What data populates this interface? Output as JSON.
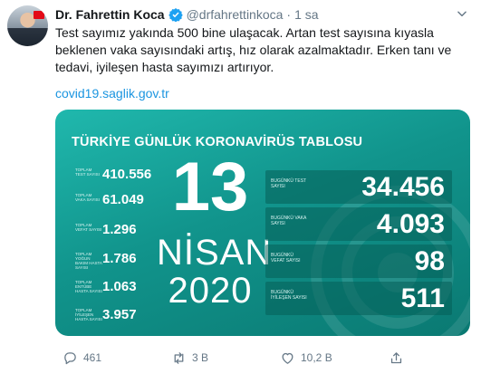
{
  "author": {
    "name": "Dr. Fahrettin Koca",
    "handle": "@drfahrettinkoca",
    "separator": "·",
    "time": "1 sa"
  },
  "tweet": {
    "text": "Test sayımız yakında 500 bine ulaşacak. Artan test sayısına kıyasla beklenen vaka sayısındaki artış, hız olarak azalmaktadır. Erken tanı ve tedavi, iyileşen hasta sayımızı artırıyor.",
    "link": "covid19.saglik.gov.tr"
  },
  "card": {
    "title": "TÜRKİYE GÜNLÜK KORONAVİRÜS TABLOSU",
    "day": "13",
    "month": "NİSAN",
    "year": "2020",
    "totals": [
      {
        "label": "TOPLAM TEST SAYISI",
        "value": "410.556"
      },
      {
        "label": "TOPLAM VAKA SAYISI",
        "value": "61.049"
      },
      {
        "label": "TOPLAM VEFAT SAYISI",
        "value": "1.296"
      },
      {
        "label": "TOPLAM YOĞUN BAKIM HASTA SAYISI",
        "value": "1.786"
      },
      {
        "label": "TOPLAM ENTÜBE HASTA SAYISI",
        "value": "1.063"
      },
      {
        "label": "TOPLAM İYİLEŞEN HASTA SAYISI",
        "value": "3.957"
      }
    ],
    "today": [
      {
        "label": "BUGÜNKÜ TEST SAYISI",
        "value": "34.456"
      },
      {
        "label": "BUGÜNKÜ VAKA SAYISI",
        "value": "4.093"
      },
      {
        "label": "BUGÜNKÜ VEFAT SAYISI",
        "value": "98"
      },
      {
        "label": "BUGÜNKÜ İYİLEŞEN SAYISI",
        "value": "511"
      }
    ]
  },
  "actions": {
    "replies": "461",
    "retweets": "3 B",
    "likes": "10,2 B"
  },
  "colors": {
    "accent": "#1b95e0",
    "card": "#11948c",
    "verified": "#1da1f2"
  },
  "icons": [
    "verified-badge-icon",
    "chevron-down-icon",
    "reply-icon",
    "retweet-icon",
    "like-icon",
    "share-icon"
  ]
}
